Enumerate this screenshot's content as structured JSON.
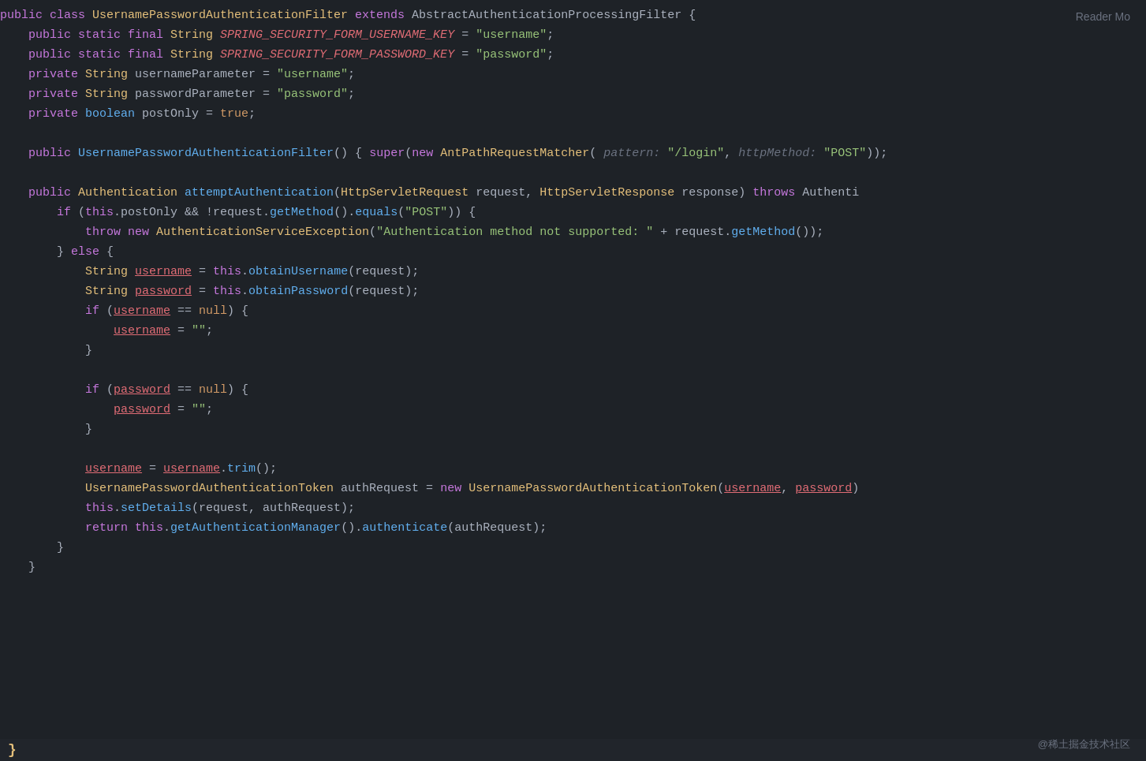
{
  "editor": {
    "reader_mode": "Reader Mo",
    "watermark": "@稀土掘金技术社区",
    "lines": [
      {
        "num": "",
        "tokens": [
          {
            "t": "kw",
            "v": "public "
          },
          {
            "t": "kw",
            "v": "class "
          },
          {
            "t": "class-name",
            "v": "UsernamePasswordAuthenticationFilter "
          },
          {
            "t": "extends-kw",
            "v": "extends "
          },
          {
            "t": "plain",
            "v": "AbstractAuthenticationProcessingFilter "
          },
          {
            "t": "plain",
            "v": "{"
          }
        ]
      },
      {
        "num": "",
        "tokens": [
          {
            "t": "plain",
            "v": "    "
          },
          {
            "t": "kw",
            "v": "public "
          },
          {
            "t": "kw",
            "v": "static "
          },
          {
            "t": "kw",
            "v": "final "
          },
          {
            "t": "type",
            "v": "String "
          },
          {
            "t": "field-italic",
            "v": "SPRING_SECURITY_FORM_USERNAME_KEY"
          },
          {
            "t": "plain",
            "v": " = "
          },
          {
            "t": "str",
            "v": "\"username\""
          },
          {
            "t": "plain",
            "v": ";"
          }
        ]
      },
      {
        "num": "",
        "tokens": [
          {
            "t": "plain",
            "v": "    "
          },
          {
            "t": "kw",
            "v": "public "
          },
          {
            "t": "kw",
            "v": "static "
          },
          {
            "t": "kw",
            "v": "final "
          },
          {
            "t": "type",
            "v": "String "
          },
          {
            "t": "field-italic",
            "v": "SPRING_SECURITY_FORM_PASSWORD_KEY"
          },
          {
            "t": "plain",
            "v": " = "
          },
          {
            "t": "str",
            "v": "\"password\""
          },
          {
            "t": "plain",
            "v": ";"
          }
        ]
      },
      {
        "num": "",
        "tokens": [
          {
            "t": "plain",
            "v": "    "
          },
          {
            "t": "kw",
            "v": "private "
          },
          {
            "t": "type",
            "v": "String "
          },
          {
            "t": "plain",
            "v": "usernameParameter = "
          },
          {
            "t": "str",
            "v": "\"username\""
          },
          {
            "t": "plain",
            "v": ";"
          }
        ]
      },
      {
        "num": "",
        "tokens": [
          {
            "t": "plain",
            "v": "    "
          },
          {
            "t": "kw",
            "v": "private "
          },
          {
            "t": "type",
            "v": "String "
          },
          {
            "t": "plain",
            "v": "passwordParameter = "
          },
          {
            "t": "str",
            "v": "\"password\""
          },
          {
            "t": "plain",
            "v": ";"
          }
        ]
      },
      {
        "num": "",
        "tokens": [
          {
            "t": "plain",
            "v": "    "
          },
          {
            "t": "kw",
            "v": "private "
          },
          {
            "t": "kw-blue",
            "v": "boolean "
          },
          {
            "t": "plain",
            "v": "postOnly = "
          },
          {
            "t": "orange",
            "v": "true"
          },
          {
            "t": "plain",
            "v": ";"
          }
        ]
      },
      {
        "num": "",
        "tokens": []
      },
      {
        "num": "",
        "tokens": [
          {
            "t": "plain",
            "v": "    "
          },
          {
            "t": "kw",
            "v": "public "
          },
          {
            "t": "fn",
            "v": "UsernamePasswordAuthenticationFilter"
          },
          {
            "t": "plain",
            "v": "() "
          },
          {
            "t": "plain",
            "v": "{ "
          },
          {
            "t": "kw",
            "v": "super"
          },
          {
            "t": "plain",
            "v": "("
          },
          {
            "t": "kw",
            "v": "new "
          },
          {
            "t": "class-name",
            "v": "AntPathRequestMatcher"
          },
          {
            "t": "plain",
            "v": "( "
          },
          {
            "t": "hint",
            "v": "pattern: "
          },
          {
            "t": "str",
            "v": "\"/login\""
          },
          {
            "t": "plain",
            "v": ", "
          },
          {
            "t": "hint",
            "v": "httpMethod: "
          },
          {
            "t": "str",
            "v": "\"POST\""
          },
          {
            "t": "plain",
            "v": "));"
          }
        ]
      },
      {
        "num": "",
        "tokens": []
      },
      {
        "num": "",
        "tokens": [
          {
            "t": "plain",
            "v": "    "
          },
          {
            "t": "kw",
            "v": "public "
          },
          {
            "t": "class-name",
            "v": "Authentication "
          },
          {
            "t": "fn",
            "v": "attemptAuthentication"
          },
          {
            "t": "plain",
            "v": "("
          },
          {
            "t": "type",
            "v": "HttpServletRequest "
          },
          {
            "t": "plain",
            "v": "request, "
          },
          {
            "t": "type",
            "v": "HttpServletResponse "
          },
          {
            "t": "plain",
            "v": "response) "
          },
          {
            "t": "kw",
            "v": "throws "
          },
          {
            "t": "plain",
            "v": "Authenti"
          }
        ]
      },
      {
        "num": "",
        "tokens": [
          {
            "t": "plain",
            "v": "        "
          },
          {
            "t": "kw",
            "v": "if "
          },
          {
            "t": "plain",
            "v": "("
          },
          {
            "t": "kw",
            "v": "this"
          },
          {
            "t": "plain",
            "v": ".postOnly && !request."
          },
          {
            "t": "fn",
            "v": "getMethod"
          },
          {
            "t": "plain",
            "v": "()."
          },
          {
            "t": "fn",
            "v": "equals"
          },
          {
            "t": "plain",
            "v": "("
          },
          {
            "t": "str",
            "v": "\"POST\""
          },
          {
            "t": "plain",
            "v": ")) {"
          }
        ]
      },
      {
        "num": "",
        "tokens": [
          {
            "t": "plain",
            "v": "            "
          },
          {
            "t": "kw",
            "v": "throw "
          },
          {
            "t": "kw",
            "v": "new "
          },
          {
            "t": "class-name",
            "v": "AuthenticationServiceException"
          },
          {
            "t": "plain",
            "v": "("
          },
          {
            "t": "str",
            "v": "\"Authentication method not supported: \""
          },
          {
            "t": "plain",
            "v": " + request."
          },
          {
            "t": "fn",
            "v": "getMethod"
          },
          {
            "t": "plain",
            "v": "());"
          }
        ]
      },
      {
        "num": "",
        "tokens": [
          {
            "t": "plain",
            "v": "        } "
          },
          {
            "t": "kw",
            "v": "else "
          },
          {
            "t": "plain",
            "v": "{"
          }
        ]
      },
      {
        "num": "",
        "tokens": [
          {
            "t": "plain",
            "v": "            "
          },
          {
            "t": "type",
            "v": "String "
          },
          {
            "t": "var-underline",
            "v": "username"
          },
          {
            "t": "plain",
            "v": " = "
          },
          {
            "t": "kw",
            "v": "this"
          },
          {
            "t": "plain",
            "v": "."
          },
          {
            "t": "fn",
            "v": "obtainUsername"
          },
          {
            "t": "plain",
            "v": "(request);"
          }
        ]
      },
      {
        "num": "",
        "tokens": [
          {
            "t": "plain",
            "v": "            "
          },
          {
            "t": "type",
            "v": "String "
          },
          {
            "t": "var-underline",
            "v": "password"
          },
          {
            "t": "plain",
            "v": " = "
          },
          {
            "t": "kw",
            "v": "this"
          },
          {
            "t": "plain",
            "v": "."
          },
          {
            "t": "fn",
            "v": "obtainPassword"
          },
          {
            "t": "plain",
            "v": "(request);"
          }
        ]
      },
      {
        "num": "",
        "tokens": [
          {
            "t": "plain",
            "v": "            "
          },
          {
            "t": "kw",
            "v": "if "
          },
          {
            "t": "plain",
            "v": "("
          },
          {
            "t": "var-underline",
            "v": "username"
          },
          {
            "t": "plain",
            "v": " == "
          },
          {
            "t": "orange",
            "v": "null"
          },
          {
            "t": "plain",
            "v": ") {"
          }
        ]
      },
      {
        "num": "",
        "tokens": [
          {
            "t": "plain",
            "v": "                "
          },
          {
            "t": "var-underline",
            "v": "username"
          },
          {
            "t": "plain",
            "v": " = "
          },
          {
            "t": "str",
            "v": "\"\""
          },
          {
            "t": "plain",
            "v": ";"
          }
        ]
      },
      {
        "num": "",
        "tokens": [
          {
            "t": "plain",
            "v": "            }"
          }
        ]
      },
      {
        "num": "",
        "tokens": []
      },
      {
        "num": "",
        "tokens": [
          {
            "t": "plain",
            "v": "            "
          },
          {
            "t": "kw",
            "v": "if "
          },
          {
            "t": "plain",
            "v": "("
          },
          {
            "t": "var-underline",
            "v": "password"
          },
          {
            "t": "plain",
            "v": " == "
          },
          {
            "t": "orange",
            "v": "null"
          },
          {
            "t": "plain",
            "v": ") {"
          }
        ]
      },
      {
        "num": "",
        "tokens": [
          {
            "t": "plain",
            "v": "                "
          },
          {
            "t": "var-underline",
            "v": "password"
          },
          {
            "t": "plain",
            "v": " = "
          },
          {
            "t": "str",
            "v": "\"\""
          },
          {
            "t": "plain",
            "v": ";"
          }
        ]
      },
      {
        "num": "",
        "tokens": [
          {
            "t": "plain",
            "v": "            }"
          }
        ]
      },
      {
        "num": "",
        "tokens": []
      },
      {
        "num": "",
        "tokens": [
          {
            "t": "plain",
            "v": "            "
          },
          {
            "t": "var-underline",
            "v": "username"
          },
          {
            "t": "plain",
            "v": " = "
          },
          {
            "t": "var-underline",
            "v": "username"
          },
          {
            "t": "plain",
            "v": "."
          },
          {
            "t": "fn",
            "v": "trim"
          },
          {
            "t": "plain",
            "v": "();"
          }
        ]
      },
      {
        "num": "",
        "tokens": [
          {
            "t": "plain",
            "v": "            "
          },
          {
            "t": "class-name",
            "v": "UsernamePasswordAuthenticationToken"
          },
          {
            "t": "plain",
            "v": " authRequest = "
          },
          {
            "t": "kw",
            "v": "new "
          },
          {
            "t": "class-name",
            "v": "UsernamePasswordAuthenticationToken"
          },
          {
            "t": "plain",
            "v": "("
          },
          {
            "t": "var-underline",
            "v": "username"
          },
          {
            "t": "plain",
            "v": ", "
          },
          {
            "t": "var-underline",
            "v": "password"
          },
          {
            "t": "plain",
            "v": ")"
          }
        ]
      },
      {
        "num": "",
        "tokens": [
          {
            "t": "plain",
            "v": "            "
          },
          {
            "t": "kw",
            "v": "this"
          },
          {
            "t": "plain",
            "v": "."
          },
          {
            "t": "fn",
            "v": "setDetails"
          },
          {
            "t": "plain",
            "v": "(request, authRequest);"
          }
        ]
      },
      {
        "num": "",
        "tokens": [
          {
            "t": "plain",
            "v": "            "
          },
          {
            "t": "kw",
            "v": "return "
          },
          {
            "t": "kw",
            "v": "this"
          },
          {
            "t": "plain",
            "v": "."
          },
          {
            "t": "fn",
            "v": "getAuthenticationManager"
          },
          {
            "t": "plain",
            "v": "()."
          },
          {
            "t": "fn",
            "v": "authenticate"
          },
          {
            "t": "plain",
            "v": "(authRequest);"
          }
        ]
      },
      {
        "num": "",
        "tokens": [
          {
            "t": "plain",
            "v": "        }"
          }
        ]
      },
      {
        "num": "",
        "tokens": [
          {
            "t": "plain",
            "v": "    }"
          }
        ]
      }
    ]
  }
}
